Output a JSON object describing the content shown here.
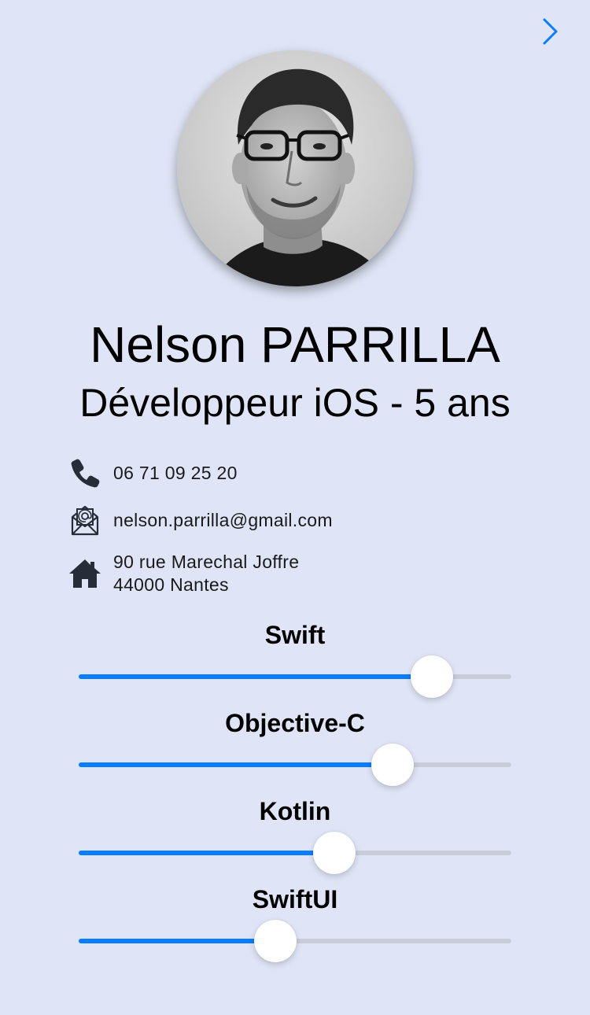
{
  "nav": {
    "next_icon": "chevron-right-icon",
    "accent": "#0a7cff"
  },
  "profile": {
    "name": "Nelson PARRILLA",
    "title": "Développeur iOS - 5 ans",
    "photo": "profile-photo"
  },
  "contact": {
    "phone": "06 71 09 25 20",
    "email": "nelson.parrilla@gmail.com",
    "address_line1": "90 rue Marechal Joffre",
    "address_line2": "44000 Nantes"
  },
  "skills": [
    {
      "label": "Swift",
      "level": 0.817
    },
    {
      "label": "Objective-C",
      "level": 0.725
    },
    {
      "label": "Kotlin",
      "level": 0.59
    },
    {
      "label": "SwiftUI",
      "level": 0.455
    }
  ],
  "colors": {
    "background": "#dfe5f6",
    "slider_fill": "#0a7cff",
    "slider_track": "#c9cdd9"
  }
}
